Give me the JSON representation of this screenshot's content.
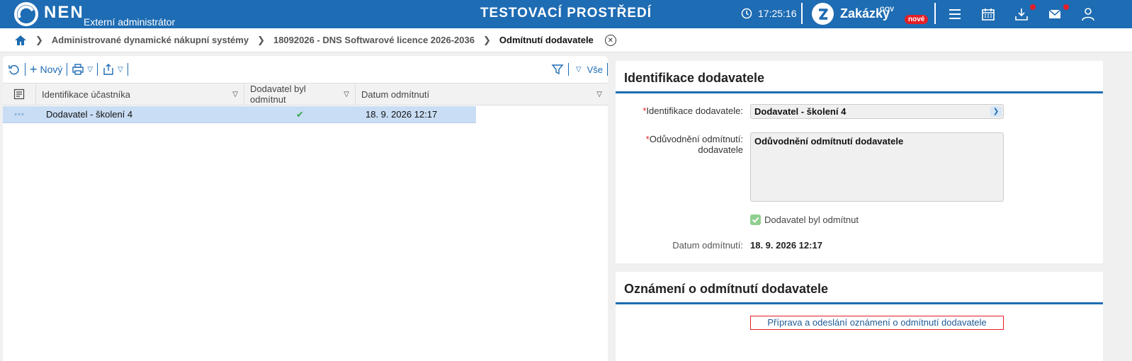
{
  "header": {
    "logo_text": "NEN",
    "logo_sub": "Externí administrátor",
    "env_title": "TESTOVACÍ PROSTŘEDÍ",
    "clock": "17:25:16",
    "zakazky_label": "Zakázky",
    "zakazky_gov": "GOV",
    "zakazky_badge": "nové",
    "icons": [
      "menu-icon",
      "calendar-icon",
      "download-icon",
      "mail-icon",
      "user-icon"
    ],
    "accent_color": "#1e6cb3"
  },
  "breadcrumb": {
    "items": [
      "Administrované dynamické nákupní systémy",
      "18092026 - DNS Softwarové licence 2026-2036",
      "Odmítnutí dodavatele"
    ]
  },
  "toolbar": {
    "new_label": "Nový",
    "filter_all_label": "Vše"
  },
  "grid": {
    "columns": [
      "Identifikace účastníka",
      "Dodavatel byl odmítnut",
      "Datum odmítnutí"
    ],
    "rows": [
      {
        "participant": "Dodavatel - školení 4",
        "rejected": true,
        "date": "18. 9. 2026 12:17"
      }
    ]
  },
  "identification": {
    "title": "Identifikace dodavatele",
    "supplier_label": "Identifikace dodavatele:",
    "supplier_value": "Dodavatel - školení 4",
    "reason_label_1": "Odůvodnění odmítnutí:",
    "reason_label_2": "dodavatele",
    "reason_value": "Odůvodnění odmítnutí dodavatele",
    "rejected_label": "Dodavatel byl odmítnut",
    "rejected_checked": true,
    "date_label": "Datum odmítnutí:",
    "date_value": "18. 9. 2026 12:17"
  },
  "notice": {
    "title": "Oznámení o odmítnutí dodavatele",
    "action_label": "Příprava a odeslání oznámení o odmítnutí dodavatele"
  }
}
